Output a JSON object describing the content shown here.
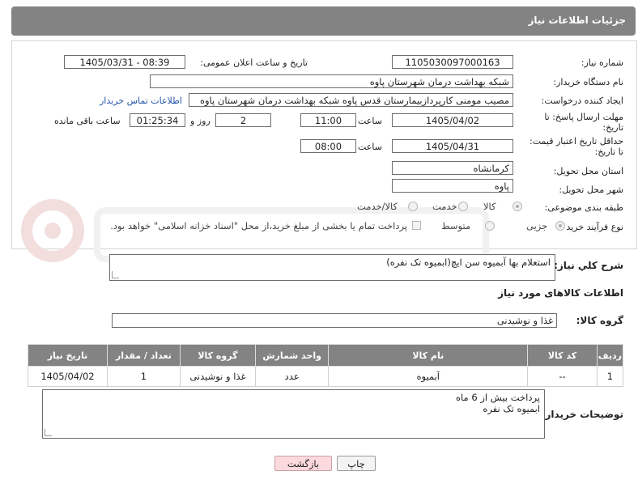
{
  "header": {
    "title": "جزئیات اطلاعات نیاز"
  },
  "form": {
    "need_number_label": "شماره نیاز:",
    "need_number": "1105030097000163",
    "announce_label": "تاریخ و ساعت اعلان عمومی:",
    "announce_value": "1405/03/31 - 08:39",
    "buyer_org_label": "نام دستگاه خریدار:",
    "buyer_org": "شبکه بهداشت درمان شهرستان پاوه",
    "creator_label": "ایجاد کننده درخواست:",
    "creator": "مصیب مومنی کارپردازبیمارستان قدس پاوه شبکه بهداشت درمان شهرستان پاوه",
    "contact_link": "اطلاعات تماس خریدار",
    "deadline_label_1": "مهلت ارسال پاسخ: تا",
    "deadline_label_2": "تاریخ:",
    "deadline_date": "1405/04/02",
    "time_label": "ساعت",
    "deadline_time": "11:00",
    "days_value": "2",
    "days_label": "روز و",
    "remaining_time": "01:25:34",
    "remaining_label": "ساعت باقی مانده",
    "price_validity_label_1": "حداقل تاریخ اعتبار قیمت:",
    "price_validity_label_2": "تا تاریخ:",
    "price_validity_date": "1405/04/31",
    "price_validity_time": "08:00",
    "province_label": "استان محل تحویل:",
    "province": "کرمانشاه",
    "city_label": "شهر محل تحویل:",
    "city": "پاوه",
    "category_label": "طبقه بندی موضوعی:",
    "category_options": [
      "کالا",
      "خدمت",
      "کالا/خدمت"
    ],
    "process_label": "نوع فرآیند خرید :",
    "process_options": [
      "جزیی",
      "متوسط"
    ],
    "payment_note": "پرداخت تمام یا بخشی از مبلغ خرید،از محل \"اسناد خزانه اسلامی\" خواهد بود."
  },
  "summary": {
    "label": "شرح کلي نياز:",
    "text": "استعلام بها آبمیوه سن ایچ(ابمیوه تک نفره)"
  },
  "goods": {
    "section_title": "اطلاعات کالاهای مورد نیاز",
    "group_label": "گروه کالا:",
    "group_value": "غذا و نوشیدنی",
    "columns": [
      "ردیف",
      "کد کالا",
      "نام کالا",
      "واحد شمارش",
      "گروه کالا",
      "تعداد / مقدار",
      "تاریخ نیاز"
    ],
    "rows": [
      [
        "1",
        "--",
        "آبمیوه",
        "عدد",
        "غذا و نوشیدنی",
        "1",
        "1405/04/02"
      ]
    ]
  },
  "buyer_notes": {
    "label": "توضیحات خریدار:",
    "lines": [
      "پرداخت بیش از 6 ماه",
      "ابمیوه تک نفره"
    ]
  },
  "buttons": {
    "print": "چاپ",
    "back": "بازگشت"
  },
  "colors": {
    "header_bg": "#838383",
    "link": "#2356a8",
    "back_button": "#fcd9dd"
  }
}
